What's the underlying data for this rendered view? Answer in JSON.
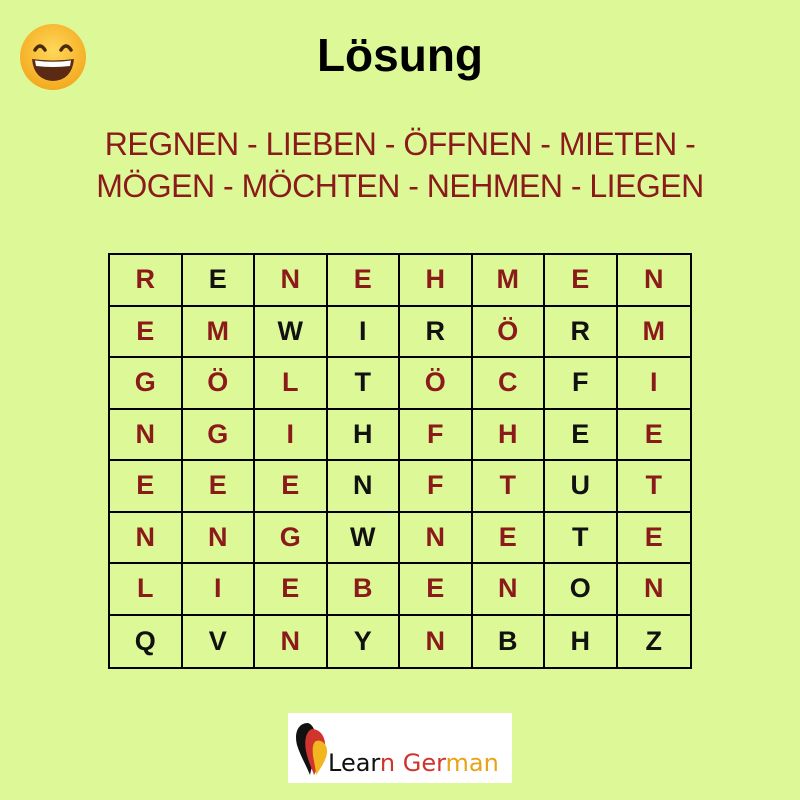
{
  "emoji": "smiling-face-with-open-mouth-and-smiling-eyes",
  "title": "Lösung",
  "words_line1": "REGNEN - LIEBEN - ÖFFNEN - MIETEN -",
  "words_line2": "MÖGEN - MÖCHTEN - NEHMEN - LIEGEN",
  "grid": [
    [
      "R",
      "E",
      "N",
      "E",
      "H",
      "M",
      "E",
      "N"
    ],
    [
      "E",
      "M",
      "W",
      "I",
      "R",
      "Ö",
      "R",
      "M"
    ],
    [
      "G",
      "Ö",
      "L",
      "T",
      "Ö",
      "C",
      "F",
      "I"
    ],
    [
      "N",
      "G",
      "I",
      "H",
      "F",
      "H",
      "E",
      "E"
    ],
    [
      "E",
      "E",
      "E",
      "N",
      "F",
      "T",
      "U",
      "T"
    ],
    [
      "N",
      "N",
      "G",
      "W",
      "N",
      "E",
      "T",
      "E"
    ],
    [
      "L",
      "I",
      "E",
      "B",
      "E",
      "N",
      "O",
      "N"
    ],
    [
      "Q",
      "V",
      "N",
      "Y",
      "N",
      "B",
      "H",
      "Z"
    ]
  ],
  "highlight": [
    [
      1,
      0,
      1,
      1,
      1,
      1,
      1,
      1
    ],
    [
      1,
      1,
      0,
      0,
      0,
      1,
      0,
      1
    ],
    [
      1,
      1,
      1,
      0,
      1,
      1,
      0,
      1
    ],
    [
      1,
      1,
      1,
      0,
      1,
      1,
      0,
      1
    ],
    [
      1,
      1,
      1,
      0,
      1,
      1,
      0,
      1
    ],
    [
      1,
      1,
      1,
      0,
      1,
      1,
      0,
      1
    ],
    [
      1,
      1,
      1,
      1,
      1,
      1,
      0,
      1
    ],
    [
      0,
      0,
      1,
      0,
      1,
      0,
      0,
      0
    ]
  ],
  "colors": {
    "background": "#ddf896",
    "highlight": "#8b1a1a",
    "normal": "#111111"
  },
  "logo": {
    "text_part1": "Lear",
    "text_part2": "n Ger",
    "text_part3": "man",
    "color_part1": "#111111",
    "color_part2": "#d0342c",
    "color_part3": "#e8a317"
  }
}
